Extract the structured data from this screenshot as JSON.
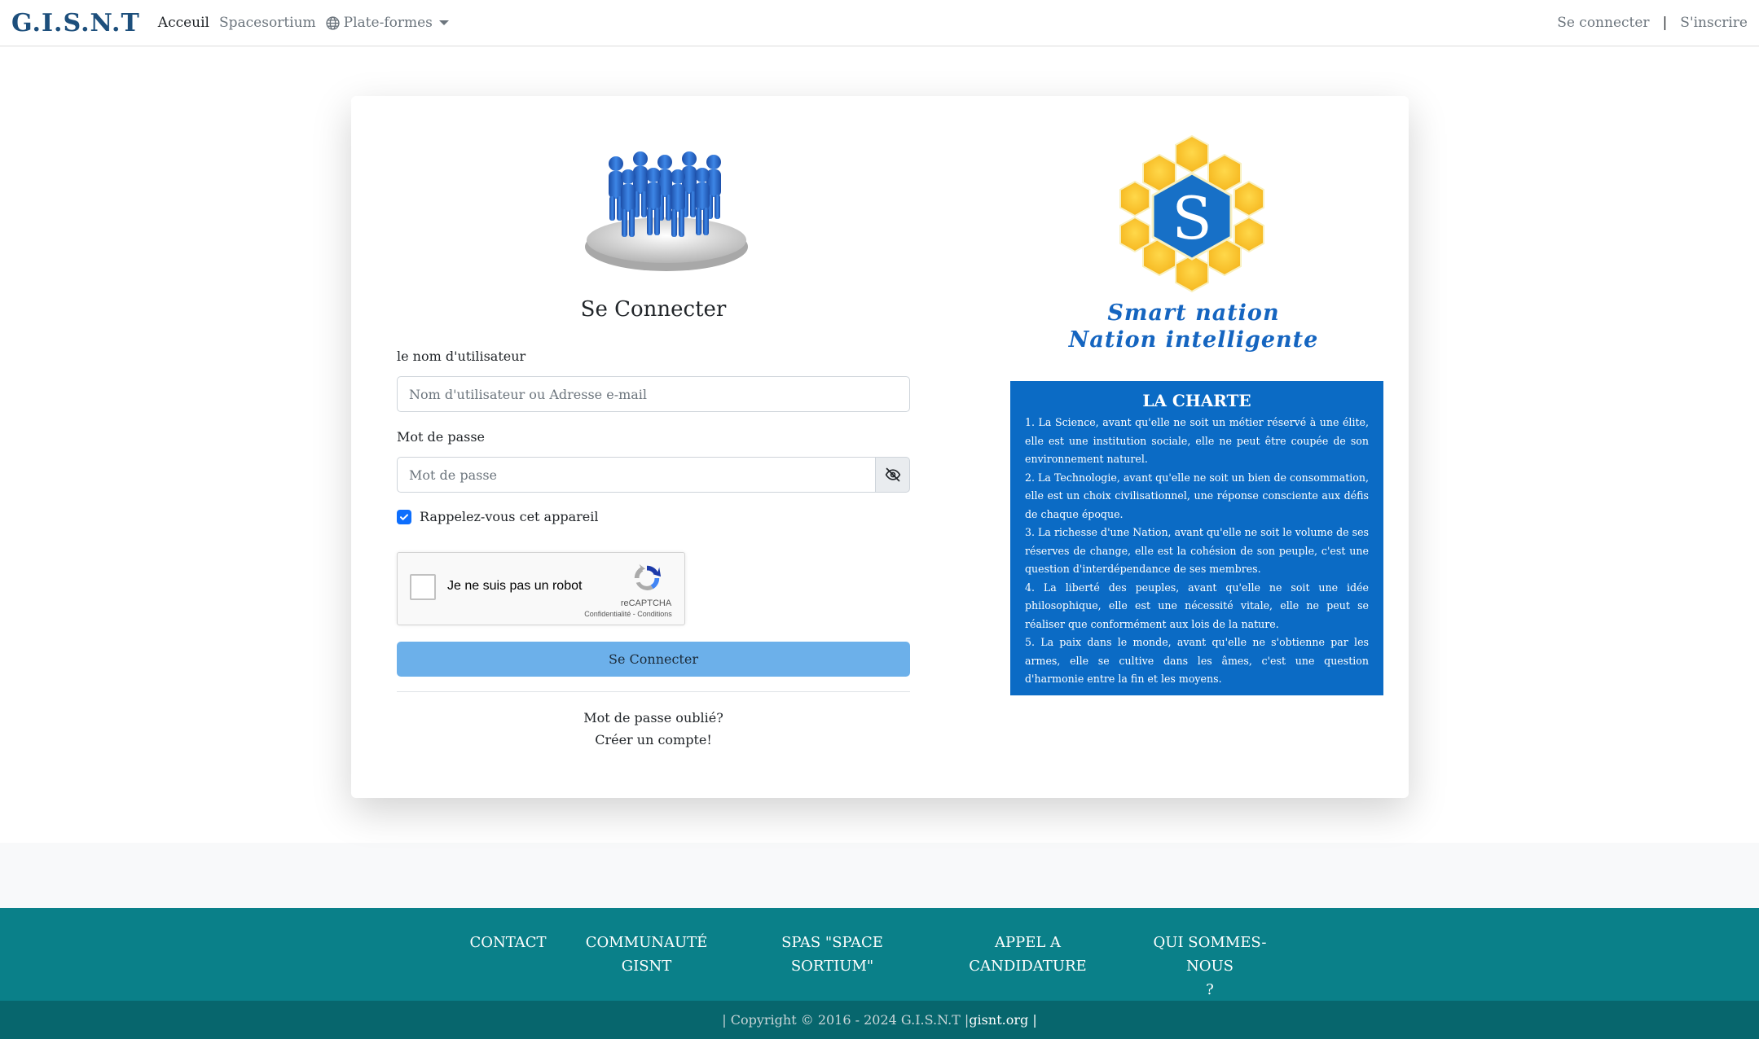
{
  "navbar": {
    "brand": "G.I.S.N.T",
    "links": [
      "Acceuil",
      "Spacesortium",
      "Plate-formes"
    ],
    "login": "Se connecter",
    "separator": "|",
    "register": "S'inscrire"
  },
  "login": {
    "title": "Se Connecter",
    "username_label": "le nom d'utilisateur",
    "username_placeholder": "Nom d'utilisateur ou Adresse e-mail",
    "password_label": "Mot de passe",
    "password_placeholder": "Mot de passe",
    "remember_label": "Rappelez-vous cet appareil",
    "remember_checked": true,
    "submit_label": "Se Connecter",
    "forgot_link": "Mot de passe oublié?",
    "create_link": "Créer un compte!"
  },
  "recaptcha": {
    "label": "Je ne suis pas un robot",
    "brand": "reCAPTCHA",
    "links": "Confidentialité - Conditions"
  },
  "logo": {
    "letter": "S",
    "slogan_line1": "Smart nation",
    "slogan_line2": "Nation intelligente"
  },
  "charte": {
    "title": "LA CHARTE",
    "items": [
      "1. La Science, avant qu'elle ne soit un métier réservé à une élite, elle est une institution sociale, elle ne peut être coupée de son environnement naturel.",
      "2. La Technologie, avant qu'elle ne soit un bien de consommation, elle est un choix civilisationnel, une réponse consciente aux défis de chaque époque.",
      "3. La richesse d'une Nation, avant qu'elle ne soit le volume de ses réserves de change, elle est la cohésion de son peuple, c'est une question d'interdépendance de ses membres.",
      "4. La liberté des peuples, avant qu'elle ne soit une idée philosophique, elle est une nécessité vitale, elle ne peut se réaliser que conformément aux lois de la nature.",
      "5. La paix dans le monde, avant qu'elle ne s'obtienne par les armes, elle se cultive dans les âmes, c'est une question d'harmonie entre la fin et les moyens."
    ]
  },
  "footer": {
    "contact": [
      "CONTACT"
    ],
    "community": [
      "COMMUNAUTÉ",
      "GISNT"
    ],
    "spas": [
      "SPAS \"SPACE",
      "SORTIUM\""
    ],
    "appel": [
      "APPEL A",
      "CANDIDATURE"
    ],
    "about": [
      "QUI SOMMES-NOUS",
      "?"
    ],
    "copyright_prefix": "| Copyright © 2016 - 2024 G.I.S.N.T |",
    "copyright_site": "gisnt.org",
    "copyright_suffix": "|"
  },
  "colors": {
    "primary": "#0d6efd",
    "submit_bg": "#6cb0ea",
    "charte_bg": "#0b6bc5",
    "footer_bg": "#0a8089",
    "copyright_bg": "#07666d"
  }
}
